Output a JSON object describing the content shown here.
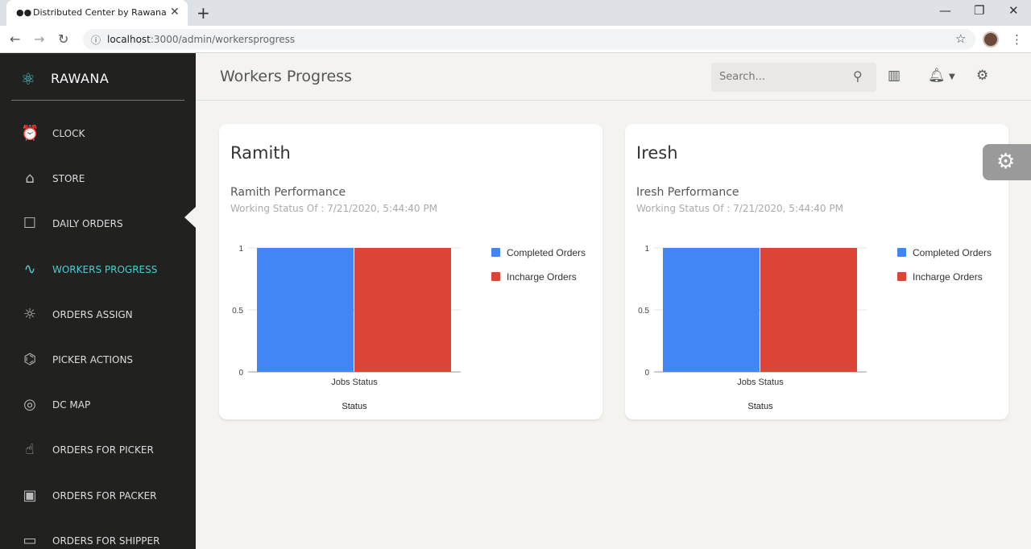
{
  "browser": {
    "tab_title": "Distributed Center by Rawana",
    "url_host": "localhost",
    "url_rest": ":3000/admin/workersprogress"
  },
  "sidebar": {
    "brand": "RAWANA",
    "items": [
      {
        "label": "CLOCK",
        "icon": "alarm-clock-icon",
        "glyph": "⏰"
      },
      {
        "label": "STORE",
        "icon": "shop-icon",
        "glyph": "⌂"
      },
      {
        "label": "DAILY ORDERS",
        "icon": "basket-icon",
        "glyph": "☐"
      },
      {
        "label": "WORKERS PROGRESS",
        "icon": "pulse-icon",
        "glyph": "∿"
      },
      {
        "label": "ORDERS ASSIGN",
        "icon": "bulb-icon",
        "glyph": "☼"
      },
      {
        "label": "PICKER ACTIONS",
        "icon": "vector-icon",
        "glyph": "⌬"
      },
      {
        "label": "DC MAP",
        "icon": "globe-icon",
        "glyph": "◎"
      },
      {
        "label": "ORDERS FOR PICKER",
        "icon": "hand-icon",
        "glyph": "☝"
      },
      {
        "label": "ORDERS FOR PACKER",
        "icon": "box-icon",
        "glyph": "▣"
      },
      {
        "label": "ORDERS FOR SHIPPER",
        "icon": "truck-icon",
        "glyph": "▭"
      }
    ]
  },
  "header": {
    "title": "Workers Progress",
    "search_placeholder": "Search..."
  },
  "cards": [
    {
      "name": "Ramith",
      "performance": "Ramith Performance",
      "status_line": "Working Status Of : 7/21/2020, 5:44:40 PM",
      "chart_data": {
        "type": "bar",
        "categories": [
          "Jobs Status"
        ],
        "series": [
          {
            "name": "Completed Orders",
            "values": [
              1
            ],
            "color": "#4285f4"
          },
          {
            "name": "Incharge Orders",
            "values": [
              1
            ],
            "color": "#db4437"
          }
        ],
        "xlabel": "Status",
        "ylim": [
          0,
          1
        ],
        "yticks": [
          "0",
          "0.5",
          "1"
        ],
        "legend": "right"
      }
    },
    {
      "name": "Iresh",
      "performance": "Iresh Performance",
      "status_line": "Working Status Of : 7/21/2020, 5:44:40 PM",
      "chart_data": {
        "type": "bar",
        "categories": [
          "Jobs Status"
        ],
        "series": [
          {
            "name": "Completed Orders",
            "values": [
              1
            ],
            "color": "#4285f4"
          },
          {
            "name": "Incharge Orders",
            "values": [
              1
            ],
            "color": "#db4437"
          }
        ],
        "xlabel": "Status",
        "ylim": [
          0,
          1
        ],
        "yticks": [
          "0",
          "0.5",
          "1"
        ],
        "legend": "right"
      }
    }
  ]
}
